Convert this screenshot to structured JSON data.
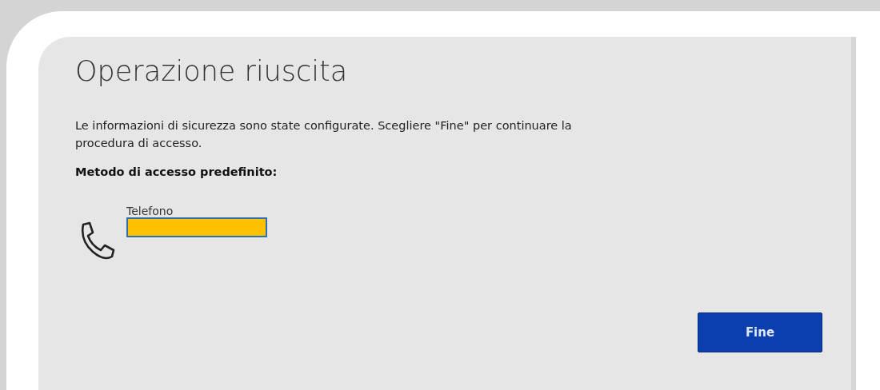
{
  "dialog": {
    "title": "Operazione riuscita",
    "message": "Le informazioni di sicurezza sono state configurate. Scegliere \"Fine\" per continuare la procedura di accesso.",
    "default_method_label": "Metodo di accesso predefinito:",
    "method": {
      "kind": "phone",
      "name": "Telefono",
      "redacted": true
    },
    "buttons": [
      {
        "label": "Fine",
        "primary": true
      }
    ]
  }
}
